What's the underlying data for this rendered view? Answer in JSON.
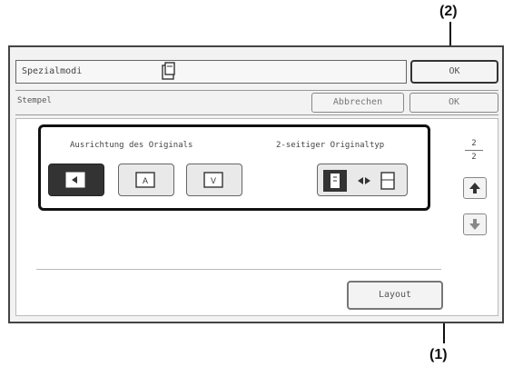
{
  "callouts": {
    "top": "(2)",
    "bottom": "(1)"
  },
  "topbar": {
    "title": "Spezialmodi",
    "ok_label": "OK"
  },
  "subbar": {
    "title": "Stempel",
    "cancel_label": "Abbrechen",
    "ok_label": "OK"
  },
  "main": {
    "orientation_label": "Ausrichtung des Originals",
    "duplex_label": "2-seitiger Originaltyp",
    "orientation_buttons": [
      {
        "icon": "orientation-left-icon",
        "selected": true
      },
      {
        "icon": "orientation-upright-icon",
        "selected": false
      },
      {
        "icon": "orientation-down-icon",
        "selected": false
      }
    ],
    "pager": {
      "current": "2",
      "total": "2"
    },
    "layout_label": "Layout"
  }
}
